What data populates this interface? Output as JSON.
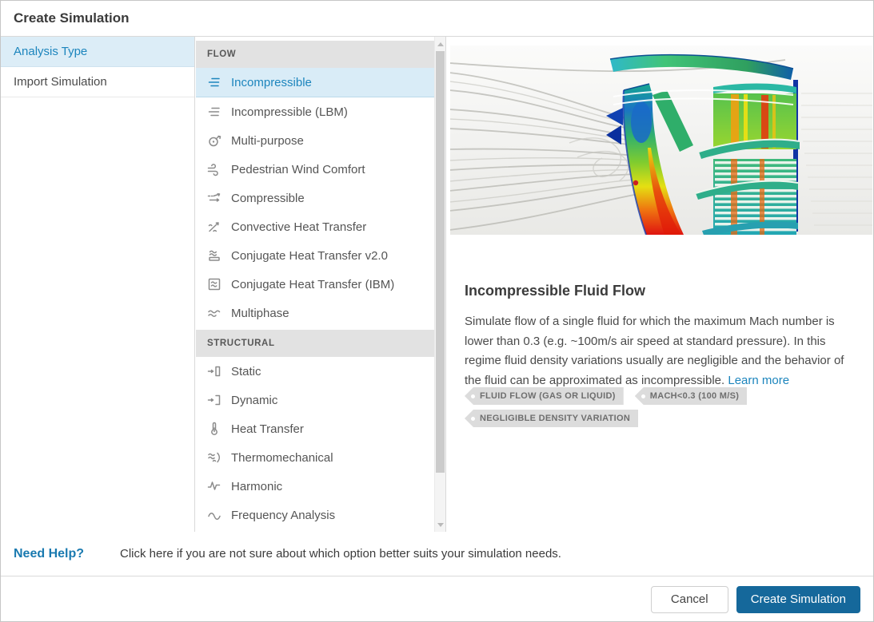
{
  "dialog": {
    "title": "Create Simulation"
  },
  "nav": {
    "items": [
      {
        "label": "Analysis Type",
        "selected": true
      },
      {
        "label": "Import Simulation",
        "selected": false
      }
    ]
  },
  "list": {
    "sections": [
      {
        "header": "FLOW",
        "items": [
          {
            "label": "Incompressible",
            "icon": "flow-lines",
            "selected": true
          },
          {
            "label": "Incompressible (LBM)",
            "icon": "flow-lines",
            "selected": false
          },
          {
            "label": "Multi-purpose",
            "icon": "multi-purpose",
            "selected": false
          },
          {
            "label": "Pedestrian Wind Comfort",
            "icon": "wind",
            "selected": false
          },
          {
            "label": "Compressible",
            "icon": "compressible-arrows",
            "selected": false
          },
          {
            "label": "Convective Heat Transfer",
            "icon": "convective",
            "selected": false
          },
          {
            "label": "Conjugate Heat Transfer v2.0",
            "icon": "cht-v2",
            "selected": false
          },
          {
            "label": "Conjugate Heat Transfer (IBM)",
            "icon": "cht-ibm",
            "selected": false
          },
          {
            "label": "Multiphase",
            "icon": "multiphase",
            "selected": false
          }
        ]
      },
      {
        "header": "STRUCTURAL",
        "items": [
          {
            "label": "Static",
            "icon": "static",
            "selected": false
          },
          {
            "label": "Dynamic",
            "icon": "dynamic",
            "selected": false
          },
          {
            "label": "Heat Transfer",
            "icon": "thermometer",
            "selected": false
          },
          {
            "label": "Thermomechanical",
            "icon": "thermomechanical",
            "selected": false
          },
          {
            "label": "Harmonic",
            "icon": "harmonic",
            "selected": false
          },
          {
            "label": "Frequency Analysis",
            "icon": "sine-wave",
            "selected": false
          }
        ]
      }
    ]
  },
  "detail": {
    "title": "Incompressible Fluid Flow",
    "description": "Simulate flow of a single fluid for which the maximum Mach number is lower than 0.3 (e.g. ~100m/s air speed at standard pressure). In this regime fluid density variations usually are negligible and the behavior of the fluid can be approximated as incompressible. ",
    "learn_more_label": "Learn more",
    "tags": [
      "FLUID FLOW (GAS OR LIQUID)",
      "MACH<0.3 (100 M/S)",
      "NEGLIGIBLE DENSITY VARIATION"
    ],
    "image_name": "cfd-wing-streamlines-visualization"
  },
  "help": {
    "title": "Need Help?",
    "text": "Click here if you are not sure about which option better suits your simulation needs."
  },
  "footer": {
    "cancel_label": "Cancel",
    "create_label": "Create Simulation"
  },
  "colors": {
    "accent": "#1c85bd",
    "primary_button": "#15689b",
    "selected_background": "#dcedf7",
    "section_header_background": "#e2e2e2"
  }
}
